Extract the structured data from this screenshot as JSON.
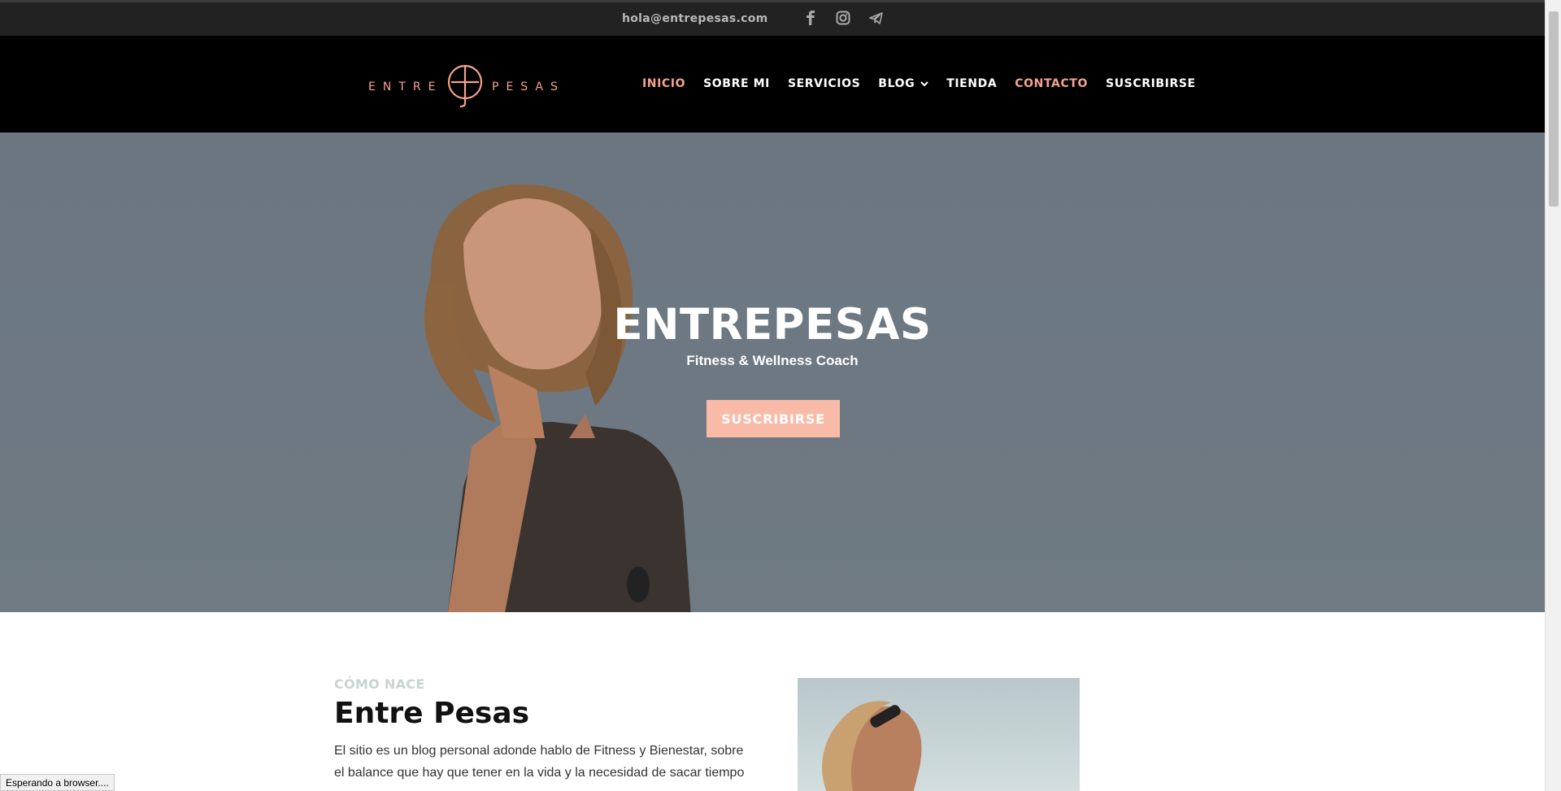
{
  "topbar": {
    "email": "hola@entrepesas.com",
    "social": [
      {
        "icon": "facebook-icon"
      },
      {
        "icon": "instagram-icon"
      },
      {
        "icon": "telegram-icon"
      }
    ]
  },
  "brand": {
    "left": "ENTRE",
    "right": "PESAS",
    "accent": "#f4a38d"
  },
  "nav": {
    "items": [
      {
        "label": "INICIO",
        "active": true
      },
      {
        "label": "SOBRE MI"
      },
      {
        "label": "SERVICIOS"
      },
      {
        "label": "BLOG"
      },
      {
        "label": "TIENDA"
      },
      {
        "label": "CONTACTO",
        "active": true
      },
      {
        "label": "SUSCRIBIRSE"
      }
    ]
  },
  "hero": {
    "title": "ENTREPESAS",
    "subtitle": "Fitness & Wellness Coach",
    "button": "SUSCRIBIRSE",
    "button_color": "#f9bba8"
  },
  "intro": {
    "eyebrow": "CÓMO NACE",
    "heading": "Entre Pesas",
    "body": "El sitio es un blog personal adonde hablo de Fitness y Bienestar, sobre el balance que hay que tener en la vida y la necesidad de sacar tiempo para uno"
  },
  "status": {
    "text": "Esperando a browser...."
  }
}
